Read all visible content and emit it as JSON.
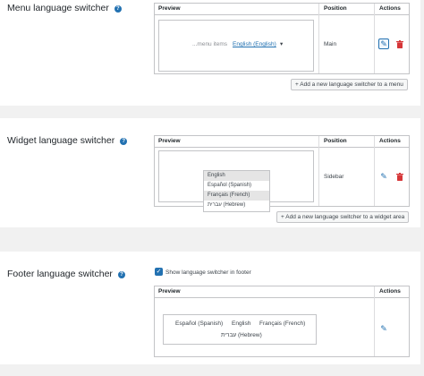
{
  "menu_section": {
    "title": "Menu language switcher",
    "headers": {
      "preview": "Preview",
      "position": "Position",
      "actions": "Actions"
    },
    "row": {
      "preview_items": "...menu items",
      "preview_link": "English (English)",
      "preview_caret": "▾",
      "position": "Main"
    },
    "add_button": "+ Add a new language switcher to a menu"
  },
  "widget_section": {
    "title": "Widget language switcher",
    "headers": {
      "preview": "Preview",
      "position": "Position",
      "actions": "Actions"
    },
    "row": {
      "position": "Sidebar",
      "dropdown_selected": "English",
      "dropdown_options": [
        "Español (Spanish)",
        "Français (French)",
        "עברית (Hebrew)"
      ]
    },
    "add_button": "+ Add a new language switcher to a widget area"
  },
  "footer_section": {
    "title": "Footer language switcher",
    "checkbox_label": "Show language switcher in footer",
    "checkbox_checked": true,
    "headers": {
      "preview": "Preview",
      "actions": "Actions"
    },
    "languages": [
      "Español (Spanish)",
      "English",
      "Français (French)",
      "עברית (Hebrew)"
    ]
  },
  "icons": {
    "help": "question-circle-icon",
    "edit": "pencil-icon",
    "delete": "trash-icon",
    "check": "checkmark-icon"
  },
  "colors": {
    "accent": "#2271b1",
    "danger": "#d63638",
    "background": "#f1f1f1"
  }
}
